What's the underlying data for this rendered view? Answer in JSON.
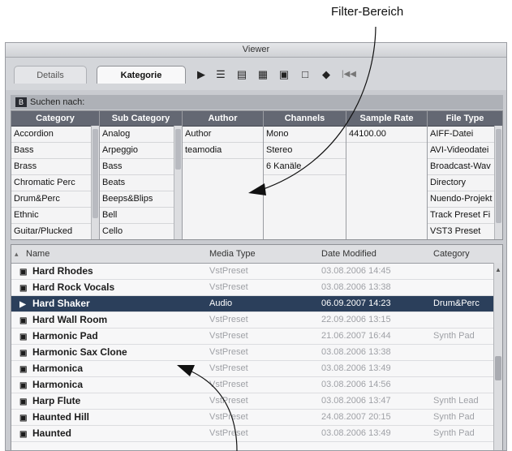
{
  "callout_top": "Filter-Bereich",
  "window": {
    "title": "Viewer",
    "tabs": [
      {
        "label": "Details"
      },
      {
        "label": "Kategorie"
      }
    ],
    "toolbar_icons": [
      "play-icon",
      "filter-icon",
      "list-icon",
      "grid-icon",
      "folder-icon",
      "frame-icon",
      "cube-icon",
      "skip-back-icon"
    ],
    "search_label": "Suchen nach:"
  },
  "filter": {
    "columns": [
      {
        "header": "Category",
        "items": [
          "Accordion",
          "Bass",
          "Brass",
          "Chromatic Perc",
          "Drum&Perc",
          "Ethnic",
          "Guitar/Plucked"
        ]
      },
      {
        "header": "Sub Category",
        "items": [
          "Analog",
          "Arpeggio",
          "Bass",
          "Beats",
          "Beeps&Blips",
          "Bell",
          "Cello"
        ]
      },
      {
        "header": "Author",
        "items": [
          "Author",
          "teamodia"
        ]
      },
      {
        "header": "Channels",
        "items": [
          "Mono",
          "Stereo",
          "6 Kanäle"
        ]
      },
      {
        "header": "Sample Rate",
        "items": [
          "44100.00"
        ]
      },
      {
        "header": "File Type",
        "items": [
          "AIFF-Datei",
          "AVI-Videodatei",
          "Broadcast-Wav",
          "Directory",
          "Nuendo-Projekt",
          "Track Preset Fi",
          "VST3 Preset"
        ]
      }
    ]
  },
  "list": {
    "headers": {
      "name": "Name",
      "media_type": "Media Type",
      "date_modified": "Date Modified",
      "category": "Category"
    },
    "rows": [
      {
        "name": "Hard Rhodes",
        "media": "VstPreset",
        "date": "03.08.2006 14:45",
        "category": ""
      },
      {
        "name": "Hard Rock Vocals",
        "media": "VstPreset",
        "date": "03.08.2006 13:38",
        "category": ""
      },
      {
        "name": "Hard Shaker",
        "media": "Audio",
        "date": "06.09.2007 14:23",
        "category": "Drum&Perc",
        "selected": true
      },
      {
        "name": "Hard Wall Room",
        "media": "VstPreset",
        "date": "22.09.2006 13:15",
        "category": ""
      },
      {
        "name": "Harmonic Pad",
        "media": "VstPreset",
        "date": "21.06.2007 16:44",
        "category": "Synth Pad"
      },
      {
        "name": "Harmonic Sax Clone",
        "media": "VstPreset",
        "date": "03.08.2006 13:38",
        "category": ""
      },
      {
        "name": "Harmonica",
        "media": "VstPreset",
        "date": "03.08.2006 13:49",
        "category": ""
      },
      {
        "name": "Harmonica",
        "media": "VstPreset",
        "date": "03.08.2006 14:56",
        "category": ""
      },
      {
        "name": "Harp Flute",
        "media": "VstPreset",
        "date": "03.08.2006 13:47",
        "category": "Synth Lead"
      },
      {
        "name": "Haunted Hill",
        "media": "VstPreset",
        "date": "24.08.2007 20:15",
        "category": "Synth Pad"
      },
      {
        "name": "Haunted",
        "media": "VstPreset",
        "date": "03.08.2006 13:49",
        "category": "Synth Pad"
      }
    ]
  },
  "colors": {
    "selected_row": "#2b3f5b",
    "filter_header": "#646873"
  }
}
